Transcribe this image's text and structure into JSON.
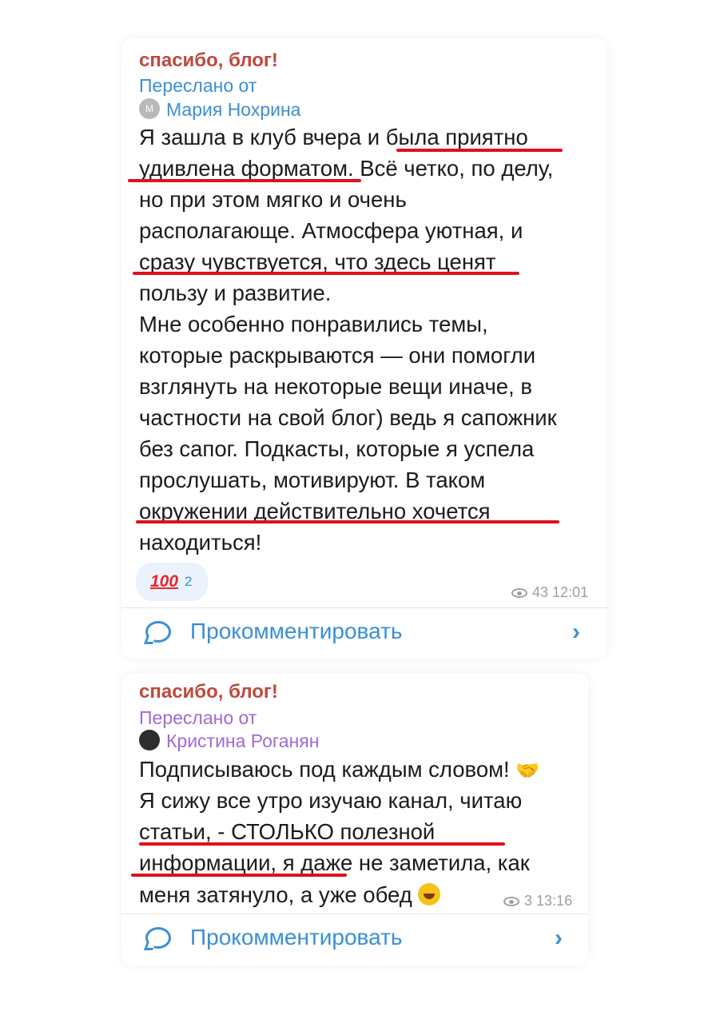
{
  "post1": {
    "channel": "спасибо, блог!",
    "forwarded_label": "Переслано от",
    "author_initial": "М",
    "author": "Мария Нохрина",
    "lines": [
      "Я зашла в клуб вчера и была приятно",
      "удивлена форматом. Всё четко, по делу,",
      "но при этом мягко и очень",
      "располагающе. Атмосфера уютная, и",
      "сразу чувствуется, что здесь ценят",
      "пользу и развитие.",
      "Мне особенно понравились темы,",
      "которые раскрываются — они помогли",
      "взглянуть на некоторые вещи иначе, в",
      "частности на свой блог) ведь я сапожник",
      "без сапог. Подкасты, которые я успела",
      "прослушать, мотивируют. В таком",
      "окружении действительно хочется",
      "находиться!"
    ],
    "reaction_emoji": "100",
    "reaction_count": "2",
    "views": "43",
    "time": "12:01",
    "comment_label": "Прокомментировать"
  },
  "post2": {
    "channel": "спасибо, блог!",
    "forwarded_label": "Переслано от",
    "author": "Кристина Роганян",
    "lines": [
      "Подписываюсь под каждым словом!",
      "Я сижу все утро изучаю канал, читаю",
      "статьи, - СТОЛЬКО полезной",
      "информации, я даже не заметила, как",
      "меня затянуло,  а уже обед"
    ],
    "views": "3",
    "time": "13:16",
    "comment_label": "Прокомментировать"
  },
  "colors": {
    "channel": "#c0483c",
    "link_blue": "#3a8fd6",
    "link_purple": "#a06ad3",
    "underline": "#e0101a",
    "meta_gray": "#9aa1a8"
  },
  "icons": [
    "eye-icon",
    "comment-bubble-icon",
    "chevron-right-icon",
    "handshake-emoji",
    "rofl-emoji",
    "hundred-emoji"
  ]
}
